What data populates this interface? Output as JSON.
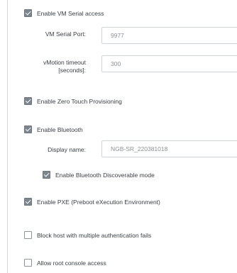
{
  "settings": {
    "vm_serial": {
      "label": "Enable VM Serial access",
      "checked": true,
      "port_label": "VM Serial Port:",
      "port_value": "9977",
      "timeout_label_line1": "vMotion timeout",
      "timeout_label_line2": "[seconds]:",
      "timeout_value": "300"
    },
    "ztp": {
      "label": "Enable Zero Touch Provisioning",
      "checked": true
    },
    "bluetooth": {
      "label": "Enable Bluetooth",
      "checked": true,
      "display_name_label": "Display name:",
      "display_name_value": "NGB-SR_220381018",
      "discoverable_label": "Enable Bluetooth Discoverable mode",
      "discoverable_checked": true
    },
    "pxe": {
      "label": "Enable PXE (Preboot eXecution Environment)",
      "checked": true
    },
    "block_host": {
      "label": "Block host with multiple authentication fails",
      "checked": false
    },
    "root_console": {
      "label": "Allow root console access",
      "checked": false
    }
  }
}
